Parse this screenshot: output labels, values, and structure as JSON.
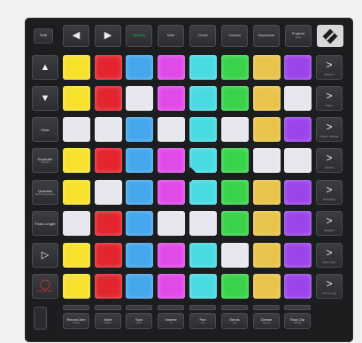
{
  "colors": {
    "yellow": "#f6e22c",
    "red": "#e2252e",
    "blue": "#44a6ec",
    "magenta": "#e04ae8",
    "cyan": "#48dbe2",
    "green": "#38d34a",
    "gold": "#e9c44a",
    "purple": "#9b44ea",
    "white": "#e6e7ee"
  },
  "top_row": [
    {
      "name": "session-button",
      "label": "Session",
      "sub": "",
      "accent": true
    },
    {
      "name": "note-button",
      "label": "Note",
      "sub": ""
    },
    {
      "name": "chord-button",
      "label": "Chord",
      "sub": ""
    },
    {
      "name": "custom-button",
      "label": "Custom",
      "sub": ""
    },
    {
      "name": "sequencer-button",
      "label": "Sequencer",
      "sub": ""
    },
    {
      "name": "projects-button",
      "label": "Projects",
      "sub": "Save"
    }
  ],
  "top_left": {
    "shift_label": "Shift",
    "left_arrow": "◀",
    "right_arrow": "▶"
  },
  "left_col": [
    {
      "name": "up-arrow-button",
      "symbol": "▲",
      "label": "",
      "sub": ""
    },
    {
      "name": "down-arrow-button",
      "symbol": "▼",
      "label": "",
      "sub": ""
    },
    {
      "name": "clear-button",
      "symbol": "",
      "label": "Clear",
      "sub": ""
    },
    {
      "name": "duplicate-button",
      "symbol": "",
      "label": "Duplicate",
      "sub": "Double"
    },
    {
      "name": "quantise-button",
      "symbol": "",
      "label": "Quantise",
      "sub": "Record Quantise"
    },
    {
      "name": "fixed-length-button",
      "symbol": "",
      "label": "Fixed Length",
      "sub": ""
    },
    {
      "name": "play-button",
      "symbol": "▷",
      "label": "",
      "sub": ""
    },
    {
      "name": "record-button",
      "symbol": "◯",
      "label": "",
      "sub": "Capture MIDI",
      "red": true
    }
  ],
  "right_col": [
    {
      "name": "scene-launch-1-button",
      "chevron": ">",
      "sub": "Patterns"
    },
    {
      "name": "scene-launch-2-button",
      "chevron": ">",
      "sub": "Steps"
    },
    {
      "name": "scene-launch-3-button",
      "chevron": ">",
      "sub": "Pattern Settings"
    },
    {
      "name": "scene-launch-4-button",
      "chevron": ">",
      "sub": "Velocity"
    },
    {
      "name": "scene-launch-5-button",
      "chevron": ">",
      "sub": "Probability"
    },
    {
      "name": "scene-launch-6-button",
      "chevron": ">",
      "sub": "Mutation"
    },
    {
      "name": "scene-launch-7-button",
      "chevron": ">",
      "sub": "Micro Step"
    },
    {
      "name": "scene-launch-8-button",
      "chevron": ">",
      "sub": "Print to Clip"
    }
  ],
  "grid": [
    [
      "yellow",
      "red",
      "blue",
      "magenta",
      "cyan",
      "green",
      "gold",
      "purple"
    ],
    [
      "yellow",
      "red",
      "white",
      "magenta",
      "cyan",
      "green",
      "gold",
      "white"
    ],
    [
      "white",
      "white",
      "blue",
      "white",
      "cyan",
      "white",
      "gold",
      "purple"
    ],
    [
      "yellow",
      "red",
      "blue",
      "magenta",
      "cyan",
      "green",
      "white",
      "white"
    ],
    [
      "yellow",
      "white",
      "blue",
      "magenta",
      "cyan",
      "green",
      "gold",
      "purple"
    ],
    [
      "white",
      "red",
      "blue",
      "white",
      "white",
      "green",
      "gold",
      "purple"
    ],
    [
      "yellow",
      "red",
      "blue",
      "magenta",
      "cyan",
      "white",
      "gold",
      "purple"
    ],
    [
      "yellow",
      "red",
      "blue",
      "magenta",
      "cyan",
      "green",
      "gold",
      "purple"
    ]
  ],
  "bottom_row": [
    {
      "name": "record-arm-button",
      "label": "Record Arm",
      "sub": "Undo"
    },
    {
      "name": "mute-button",
      "label": "Mute",
      "sub": "Redo"
    },
    {
      "name": "solo-button",
      "label": "Solo",
      "sub": "Click"
    },
    {
      "name": "volume-button",
      "label": "Volume",
      "sub": "●"
    },
    {
      "name": "pan-button",
      "label": "Pan",
      "sub": "● ●"
    },
    {
      "name": "sends-button",
      "label": "Sends",
      "sub": "Tap"
    },
    {
      "name": "device-button",
      "label": "Device",
      "sub": "Tempo"
    },
    {
      "name": "stop-clip-button",
      "label": "Stop Clip",
      "sub": "Swing"
    }
  ]
}
